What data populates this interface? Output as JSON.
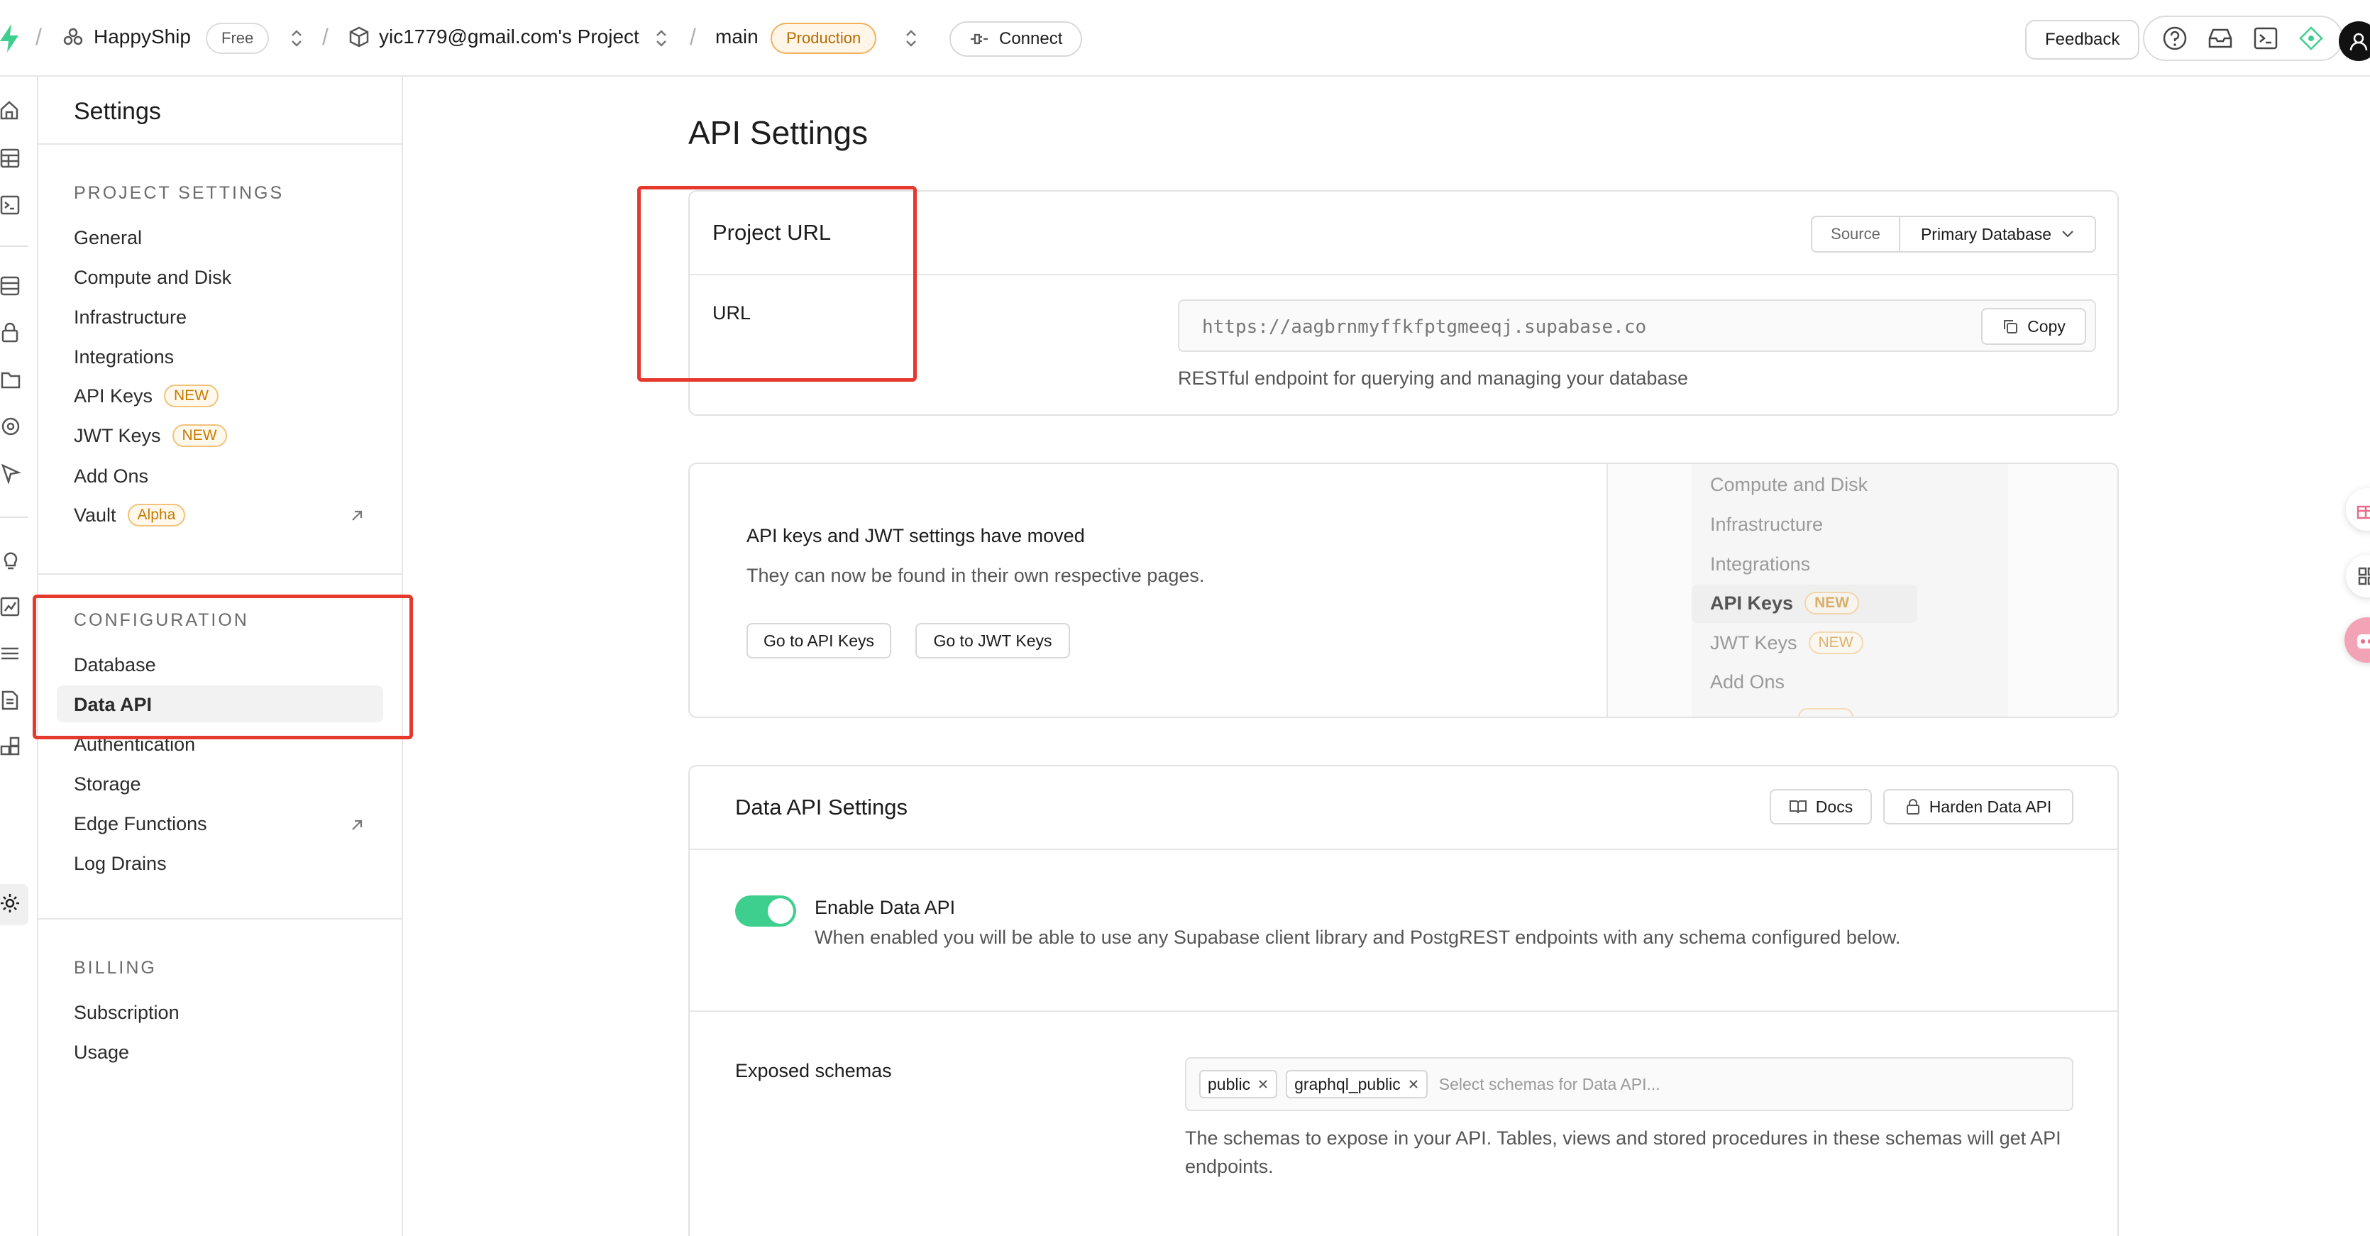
{
  "topbar": {
    "org_name": "HappyShip",
    "plan": "Free",
    "project_name": "yic1779@gmail.com's Project",
    "branch": "main",
    "env": "Production",
    "connect": "Connect",
    "feedback": "Feedback",
    "sep": "/"
  },
  "sidebar": {
    "title": "Settings",
    "project_settings_label": "PROJECT SETTINGS",
    "project_items": [
      "General",
      "Compute and Disk",
      "Infrastructure",
      "Integrations",
      "API Keys",
      "JWT Keys",
      "Add Ons",
      "Vault"
    ],
    "new_badge": "NEW",
    "alpha_badge": "Alpha",
    "configuration_label": "CONFIGURATION",
    "configuration_items": [
      "Database",
      "Data API",
      "Authentication",
      "Storage",
      "Edge Functions",
      "Log Drains"
    ],
    "billing_label": "BILLING",
    "billing_items": [
      "Subscription",
      "Usage"
    ]
  },
  "main": {
    "title": "API Settings",
    "project_url": {
      "heading": "Project URL",
      "source_label": "Source",
      "source_value": "Primary Database",
      "url_label": "URL",
      "url_value": "https://aagbrnmyffkfptgmeeqj.supabase.co",
      "copy": "Copy",
      "help": "RESTful endpoint for querying and managing your database"
    },
    "moved": {
      "title": "API keys and JWT settings have moved",
      "desc": "They can now be found in their own respective pages.",
      "btn_api": "Go to API Keys",
      "btn_jwt": "Go to JWT Keys",
      "preview_items": [
        "Compute and Disk",
        "Infrastructure",
        "Integrations",
        "API Keys",
        "JWT Keys",
        "Add Ons"
      ],
      "new_badge": "NEW"
    },
    "data_api": {
      "heading": "Data API Settings",
      "docs": "Docs",
      "harden": "Harden Data API",
      "enable_title": "Enable Data API",
      "enable_desc": "When enabled you will be able to use any Supabase client library and PostgREST endpoints with any schema configured below.",
      "enabled": true,
      "schemas_label": "Exposed schemas",
      "schemas": [
        "public",
        "graphql_public"
      ],
      "schemas_placeholder": "Select schemas for Data API...",
      "schemas_help": "The schemas to expose in your API. Tables, views and stored procedures in these schemas will get API endpoints."
    }
  },
  "colors": {
    "accent": "#3ecf8e",
    "annotation": "#e5392e",
    "badge": "#c77a00"
  }
}
